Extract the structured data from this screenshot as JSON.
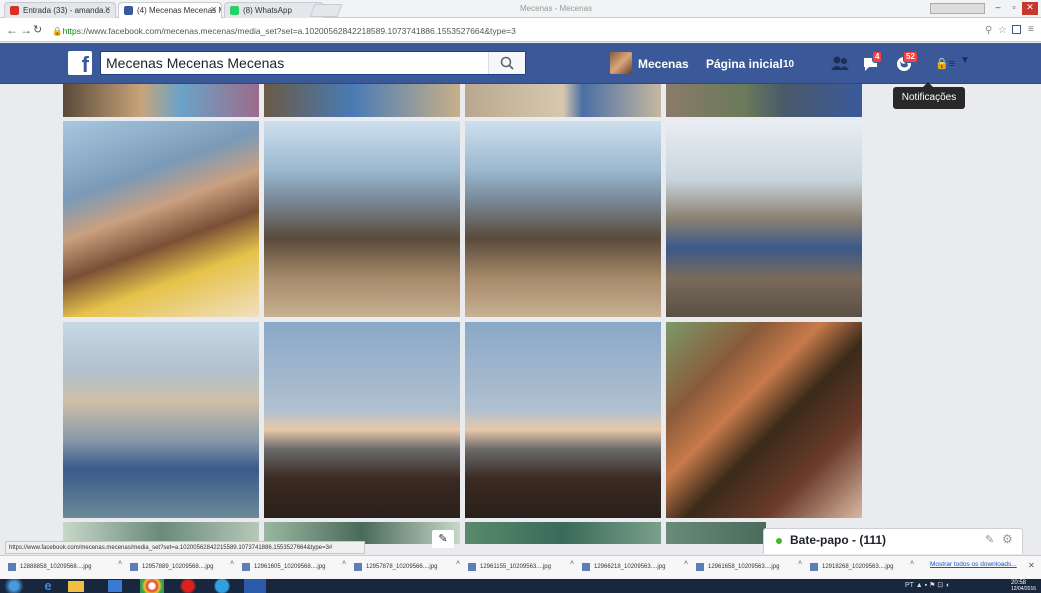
{
  "browser": {
    "tabs": [
      {
        "label": "Entrada (33) - amanda.c",
        "icon_color": "#d93025"
      },
      {
        "label": "(4) Mecenas Mecenas M",
        "icon_color": "#3b5998"
      },
      {
        "label": "(8) WhatsApp",
        "icon_color": "#25d366"
      }
    ],
    "url_secure": "https",
    "url": "://www.facebook.com/mecenas.mecenas/media_set?set=a.1020056284221858​9.1073741886.1553527664&type=3",
    "window_title": "Mecenas - Mecenas"
  },
  "facebook": {
    "search_value": "Mecenas Mecenas Mecenas",
    "user_name": "Mecenas",
    "home_label": "Página inicial",
    "home_count": "10",
    "friend_badge": "",
    "message_badge": "4",
    "notification_badge": "52",
    "notification_tooltip": "Notificações"
  },
  "chat": {
    "label": "Bate-papo - (111)"
  },
  "status_url": "https://www.facebook.com/mecenas.mecenas/media_set?set=a.10200562842215589.1073741886.1553527664&type=3#",
  "downloads": [
    "12888858_10209568....jpg",
    "12957889_10209568....jpg",
    "12961605_10209568....jpg",
    "12957878_10209566....jpg",
    "12961155_10209563....jpg",
    "12966218_10209563....jpg",
    "12961658_10209563....jpg",
    "12918268_10209563....jpg"
  ],
  "downloads_show_all": "Mostrar todos os downloads...",
  "taskbar": {
    "clock_time": "20:58",
    "clock_date": "12/04/2016"
  },
  "colors": {
    "facebook_blue": "#3b5998",
    "badge_red": "#fa3e3e",
    "chat_online": "#42b72a"
  }
}
